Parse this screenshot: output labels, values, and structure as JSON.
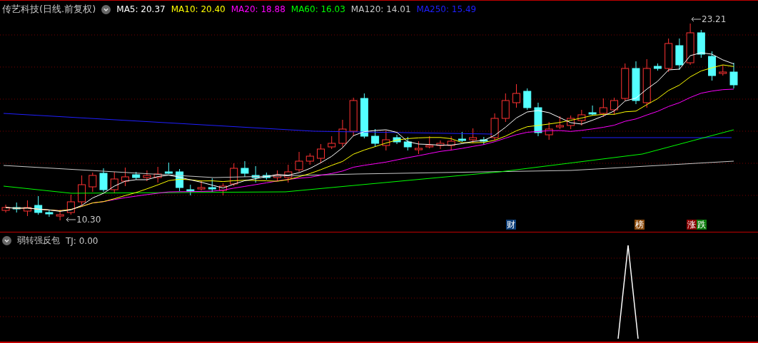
{
  "title": "传艺科技(日线.前复权)",
  "ma_legend": [
    {
      "label": "MA5: 20.37",
      "color": "#ffffff"
    },
    {
      "label": "MA10: 20.40",
      "color": "#ffff00"
    },
    {
      "label": "MA20: 18.88",
      "color": "#ff00ff"
    },
    {
      "label": "MA60: 16.03",
      "color": "#00ff00"
    },
    {
      "label": "MA120: 14.01",
      "color": "#c8c8c8"
    },
    {
      "label": "MA250: 15.49",
      "color": "#1f1fff"
    }
  ],
  "price_labels": [
    {
      "kind": "high",
      "text": "23.21"
    },
    {
      "kind": "low",
      "text": "10.30"
    }
  ],
  "event_markers": [
    {
      "text": "财",
      "color": "#0b3d78"
    },
    {
      "text": "榜",
      "color": "#8a4a0c"
    },
    {
      "text": "涨",
      "color": "#8a0000"
    },
    {
      "text": "跌",
      "color": "#0c7a0c"
    }
  ],
  "indicator": {
    "name": "弱转强反包",
    "reading": "TJ: 0.00"
  }
}
